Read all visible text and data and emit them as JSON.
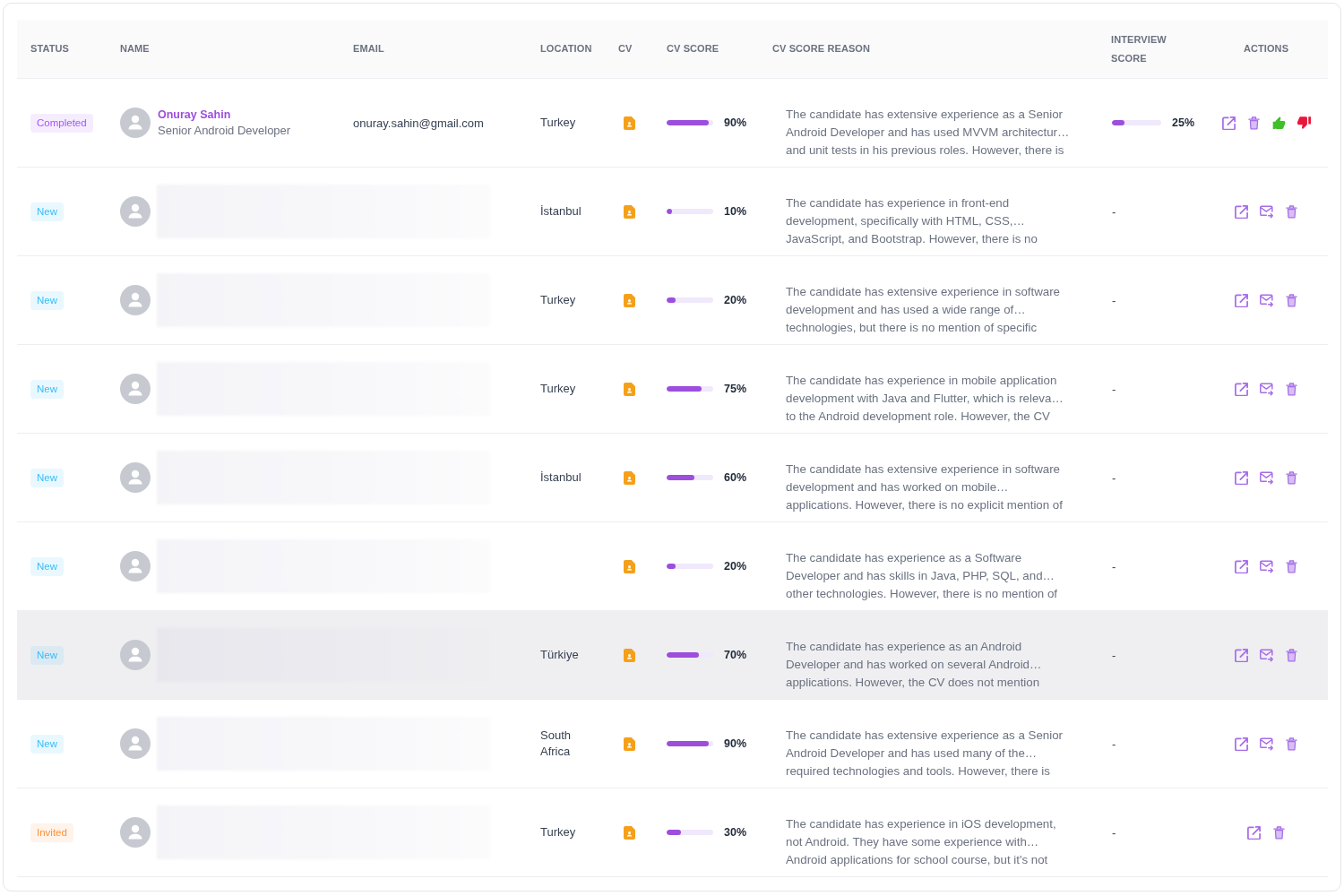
{
  "table": {
    "columns": [
      "STATUS",
      "NAME",
      "EMAIL",
      "LOCATION",
      "CV",
      "CV SCORE",
      "CV SCORE REASON",
      "INTERVIEW SCORE",
      "ACTIONS"
    ],
    "rows": [
      {
        "status": {
          "label": "Completed",
          "color": "#a855f7"
        },
        "blurred": false,
        "name": "Onuray Sahin",
        "title": "Senior Android Developer",
        "email": "onuray.sahin@gmail.com",
        "location": "Turkey",
        "cv_score": {
          "level": 0.9,
          "reading": "90%"
        },
        "reason": [
          "The candidate has extensive experience as a Senior",
          "Android Developer and has used MVVM architectur…",
          "and unit tests in his previous roles. However, there is"
        ],
        "interview_score": {
          "level": 0.25,
          "reading": "25%"
        },
        "actions": [
          {
            "kind": "open"
          },
          {
            "kind": "delete"
          },
          {
            "kind": "approve"
          },
          {
            "kind": "reject"
          }
        ],
        "highlighted": false
      },
      {
        "status": {
          "label": "New",
          "color": "#38bdf8"
        },
        "blurred": true,
        "location": "İstanbul",
        "cv_score": {
          "level": 0.1,
          "reading": "10%"
        },
        "reason": [
          "The candidate has experience in front-end",
          "development, specifically with HTML, CSS,…",
          "JavaScript, and Bootstrap. However, there is no"
        ],
        "interview_score": {
          "reading": "-"
        },
        "actions": [
          {
            "kind": "open"
          },
          {
            "kind": "email"
          },
          {
            "kind": "delete"
          }
        ],
        "highlighted": false
      },
      {
        "status": {
          "label": "New",
          "color": "#38bdf8"
        },
        "blurred": true,
        "location": "Turkey",
        "cv_score": {
          "level": 0.2,
          "reading": "20%"
        },
        "reason": [
          "The candidate has extensive experience in software",
          "development and has used a wide range of…",
          "technologies, but there is no mention of specific"
        ],
        "interview_score": {
          "reading": "-"
        },
        "actions": [
          {
            "kind": "open"
          },
          {
            "kind": "email"
          },
          {
            "kind": "delete"
          }
        ],
        "highlighted": false
      },
      {
        "status": {
          "label": "New",
          "color": "#38bdf8"
        },
        "blurred": true,
        "location": "Turkey",
        "cv_score": {
          "level": 0.75,
          "reading": "75%"
        },
        "reason": [
          "The candidate has experience in mobile application",
          "development with Java and Flutter, which is releva…",
          "to the Android development role. However, the CV"
        ],
        "interview_score": {
          "reading": "-"
        },
        "actions": [
          {
            "kind": "open"
          },
          {
            "kind": "email"
          },
          {
            "kind": "delete"
          }
        ],
        "highlighted": false
      },
      {
        "status": {
          "label": "New",
          "color": "#38bdf8"
        },
        "blurred": true,
        "location": "İstanbul",
        "cv_score": {
          "level": 0.6,
          "reading": "60%"
        },
        "reason": [
          "The candidate has extensive experience in software",
          "development and has worked on mobile…",
          "applications. However, there is no explicit mention of"
        ],
        "interview_score": {
          "reading": "-"
        },
        "actions": [
          {
            "kind": "open"
          },
          {
            "kind": "email"
          },
          {
            "kind": "delete"
          }
        ],
        "highlighted": false
      },
      {
        "status": {
          "label": "New",
          "color": "#38bdf8"
        },
        "blurred": true,
        "cv_score": {
          "level": 0.2,
          "reading": "20%"
        },
        "reason": [
          "The candidate has experience as a Software",
          "Developer and has skills in Java, PHP, SQL, and…",
          "other technologies. However, there is no mention of"
        ],
        "interview_score": {
          "reading": "-"
        },
        "actions": [
          {
            "kind": "open"
          },
          {
            "kind": "email"
          },
          {
            "kind": "delete"
          }
        ],
        "highlighted": false
      },
      {
        "status": {
          "label": "New",
          "color": "#38bdf8"
        },
        "blurred": true,
        "location": "Türkiye",
        "cv_score": {
          "level": 0.7,
          "reading": "70%"
        },
        "reason": [
          "The candidate has experience as an Android",
          "Developer and has worked on several Android…",
          "applications. However, the CV does not mention"
        ],
        "interview_score": {
          "reading": "-"
        },
        "actions": [
          {
            "kind": "open"
          },
          {
            "kind": "email"
          },
          {
            "kind": "delete"
          }
        ],
        "highlighted": true
      },
      {
        "status": {
          "label": "New",
          "color": "#38bdf8"
        },
        "blurred": true,
        "location": "South Africa",
        "cv_score": {
          "level": 0.9,
          "reading": "90%"
        },
        "reason": [
          "The candidate has extensive experience as a Senior",
          "Android Developer and has used many of the…",
          "required technologies and tools. However, there is"
        ],
        "interview_score": {
          "reading": "-"
        },
        "actions": [
          {
            "kind": "open"
          },
          {
            "kind": "email"
          },
          {
            "kind": "delete"
          }
        ],
        "highlighted": false
      },
      {
        "status": {
          "label": "Invited",
          "color": "#fb923c"
        },
        "blurred": true,
        "location": "Turkey",
        "cv_score": {
          "level": 0.3,
          "reading": "30%"
        },
        "reason": [
          "The candidate has experience in iOS development,",
          "not Android. They have some experience with…",
          "Android applications for school course, but it's not"
        ],
        "interview_score": {
          "reading": "-"
        },
        "actions": [
          {
            "kind": "open"
          },
          {
            "kind": "delete"
          }
        ],
        "highlighted": false
      }
    ]
  }
}
